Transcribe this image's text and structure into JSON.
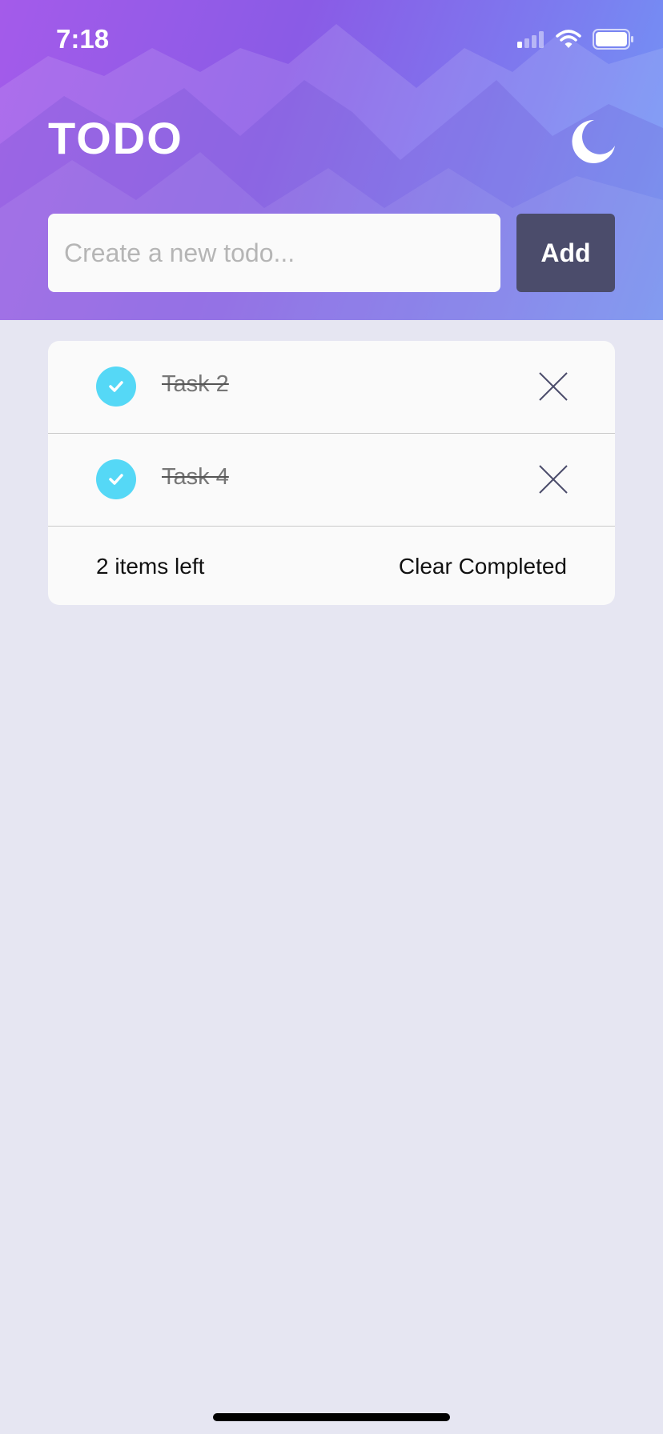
{
  "status_bar": {
    "time": "7:18",
    "icons": [
      "signal-icon",
      "wifi-icon",
      "battery-icon"
    ]
  },
  "header": {
    "title": "TODO",
    "theme_icon": "moon-icon"
  },
  "new_todo": {
    "placeholder": "Create a new todo...",
    "value": "",
    "add_label": "Add"
  },
  "todos": [
    {
      "text": "Task 2",
      "completed": true
    },
    {
      "text": "Task 4",
      "completed": true
    }
  ],
  "footer": {
    "items_left": "2 items left",
    "clear_label": "Clear Completed"
  },
  "colors": {
    "accent": "#55d8f6",
    "button": "#4b4c6b",
    "background": "#e6e6f2"
  }
}
